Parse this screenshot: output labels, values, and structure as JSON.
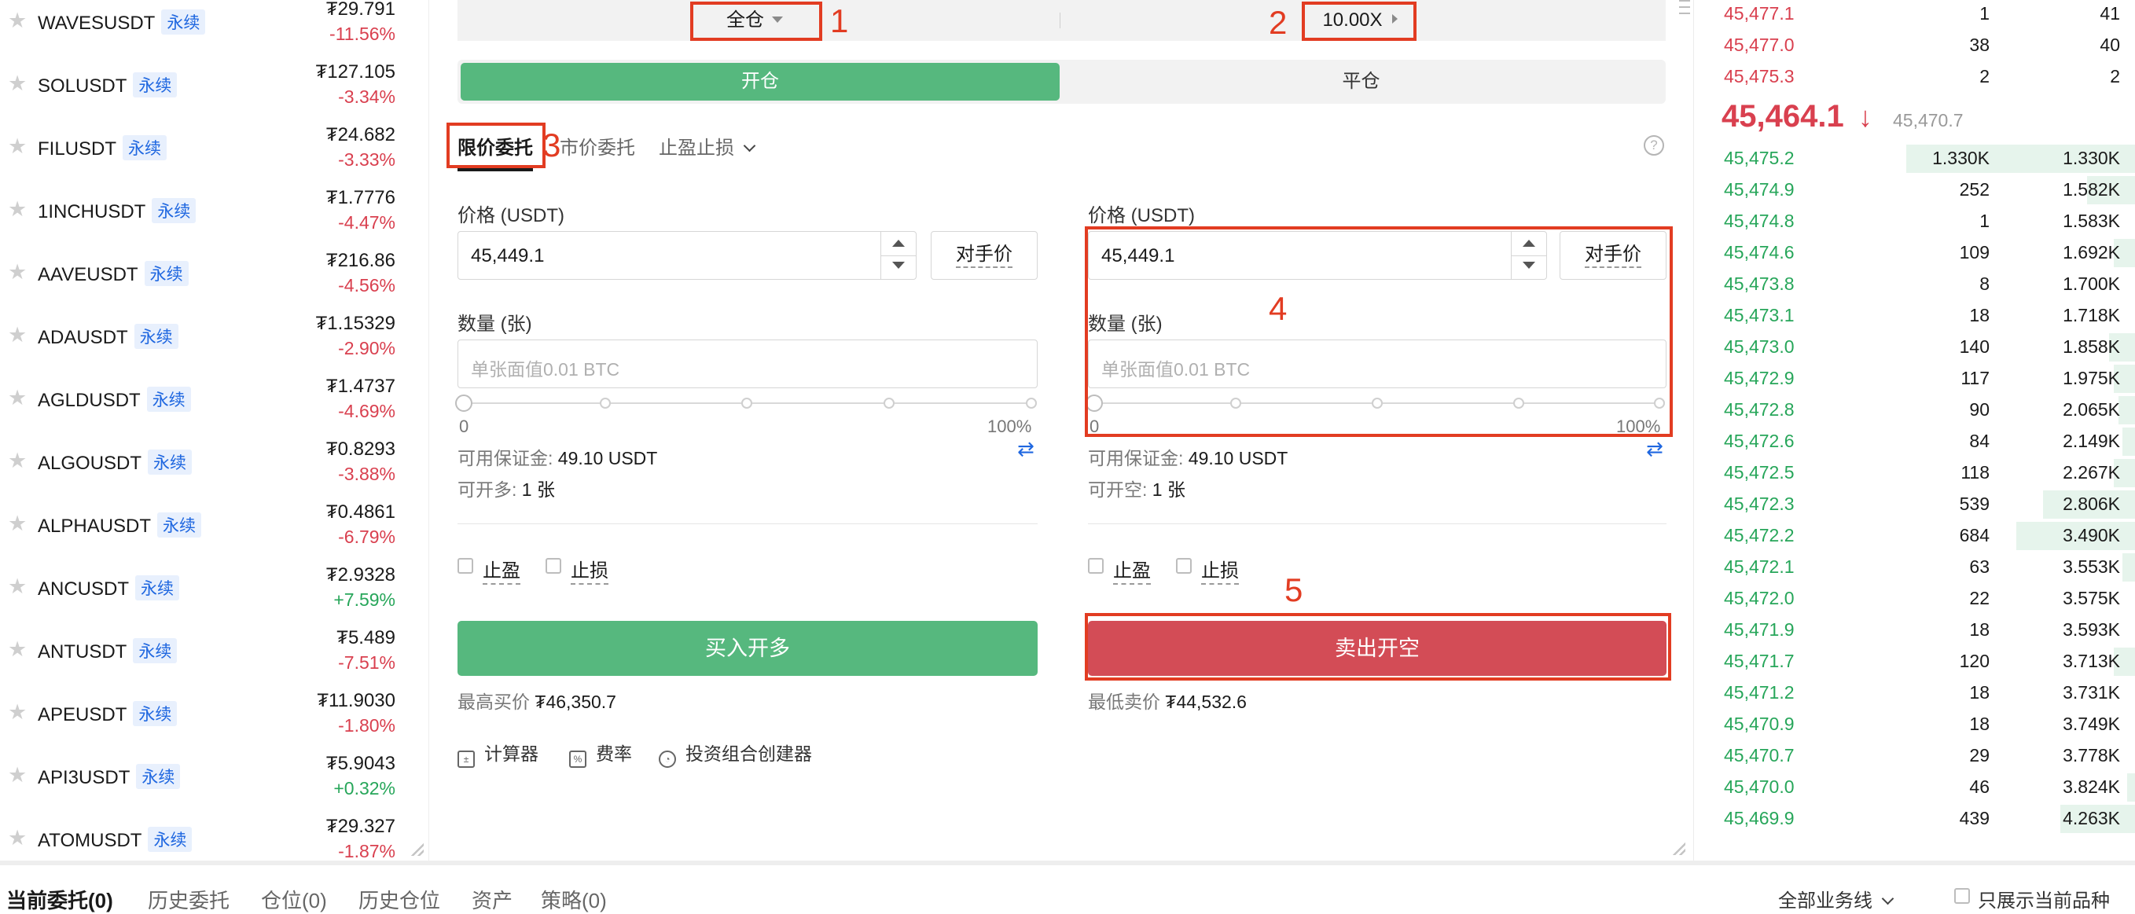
{
  "symbols": [
    {
      "name": "WAVESUSDT",
      "badge": "永续",
      "price": "₮29.791",
      "change": "-11.56%",
      "dir": "neg"
    },
    {
      "name": "SOLUSDT",
      "badge": "永续",
      "price": "₮127.105",
      "change": "-3.34%",
      "dir": "neg"
    },
    {
      "name": "FILUSDT",
      "badge": "永续",
      "price": "₮24.682",
      "change": "-3.33%",
      "dir": "neg"
    },
    {
      "name": "1INCHUSDT",
      "badge": "永续",
      "price": "₮1.7776",
      "change": "-4.47%",
      "dir": "neg"
    },
    {
      "name": "AAVEUSDT",
      "badge": "永续",
      "price": "₮216.86",
      "change": "-4.56%",
      "dir": "neg"
    },
    {
      "name": "ADAUSDT",
      "badge": "永续",
      "price": "₮1.15329",
      "change": "-2.90%",
      "dir": "neg"
    },
    {
      "name": "AGLDUSDT",
      "badge": "永续",
      "price": "₮1.4737",
      "change": "-4.69%",
      "dir": "neg"
    },
    {
      "name": "ALGOUSDT",
      "badge": "永续",
      "price": "₮0.8293",
      "change": "-3.88%",
      "dir": "neg"
    },
    {
      "name": "ALPHAUSDT",
      "badge": "永续",
      "price": "₮0.4861",
      "change": "-6.79%",
      "dir": "neg"
    },
    {
      "name": "ANCUSDT",
      "badge": "永续",
      "price": "₮2.9328",
      "change": "+7.59%",
      "dir": "pos"
    },
    {
      "name": "ANTUSDT",
      "badge": "永续",
      "price": "₮5.489",
      "change": "-7.51%",
      "dir": "neg"
    },
    {
      "name": "APEUSDT",
      "badge": "永续",
      "price": "₮11.9030",
      "change": "-1.80%",
      "dir": "neg"
    },
    {
      "name": "API3USDT",
      "badge": "永续",
      "price": "₮5.9043",
      "change": "+0.32%",
      "dir": "pos"
    },
    {
      "name": "ATOMUSDT",
      "badge": "永续",
      "price": "₮29.327",
      "change": "-1.87%",
      "dir": "neg"
    }
  ],
  "trade": {
    "margin_mode": "全仓",
    "leverage": "10.00X",
    "open_tab": "开仓",
    "close_tab": "平仓",
    "order_tabs": [
      "限价委托",
      "市价委托",
      "止盈止损"
    ],
    "price_label": "价格 (USDT)",
    "qty_label": "数量 (张)",
    "counter_price": "对手价",
    "buy": {
      "price_value": "45,449.1",
      "qty_placeholder": "单张面值0.01 BTC",
      "slider_min": "0",
      "slider_max": "100%",
      "margin_label": "可用保证金:",
      "margin_value": "49.10 USDT",
      "can_open_label": "可开多:",
      "can_open_value": "1 张",
      "tp_label": "止盈",
      "sl_label": "止损",
      "button": "买入开多",
      "limit_label": "最高买价",
      "limit_value": "₮46,350.7"
    },
    "sell": {
      "price_value": "45,449.1",
      "qty_placeholder": "单张面值0.01 BTC",
      "slider_min": "0",
      "slider_max": "100%",
      "margin_label": "可用保证金:",
      "margin_value": "49.10 USDT",
      "can_open_label": "可开空:",
      "can_open_value": "1 张",
      "tp_label": "止盈",
      "sl_label": "止损",
      "button": "卖出开空",
      "limit_label": "最低卖价",
      "limit_value": "₮44,532.6"
    },
    "tools": [
      "计算器",
      "费率",
      "投资组合创建器"
    ],
    "annotations": [
      "1",
      "2",
      "3",
      "4",
      "5"
    ]
  },
  "orderbook": {
    "asks": [
      {
        "price": "45,477.1",
        "qty": "1",
        "total": "41"
      },
      {
        "price": "45,477.0",
        "qty": "38",
        "total": "40"
      },
      {
        "price": "45,475.3",
        "qty": "2",
        "total": "2"
      }
    ],
    "last_price": "45,464.1",
    "last_arrow": "↓",
    "mark_price": "45,470.7",
    "bids": [
      {
        "price": "45,475.2",
        "qty": "1.330K",
        "total": "1.330K",
        "depth": 0.52
      },
      {
        "price": "45,474.9",
        "qty": "252",
        "total": "1.582K",
        "depth": 0.11
      },
      {
        "price": "45,474.8",
        "qty": "1",
        "total": "1.583K",
        "depth": 0.0
      },
      {
        "price": "45,474.6",
        "qty": "109",
        "total": "1.692K",
        "depth": 0.05
      },
      {
        "price": "45,473.8",
        "qty": "8",
        "total": "1.700K",
        "depth": 0.0
      },
      {
        "price": "45,473.1",
        "qty": "18",
        "total": "1.718K",
        "depth": 0.0
      },
      {
        "price": "45,473.0",
        "qty": "140",
        "total": "1.858K",
        "depth": 0.06
      },
      {
        "price": "45,472.9",
        "qty": "117",
        "total": "1.975K",
        "depth": 0.05
      },
      {
        "price": "45,472.8",
        "qty": "90",
        "total": "2.065K",
        "depth": 0.04
      },
      {
        "price": "45,472.6",
        "qty": "84",
        "total": "2.149K",
        "depth": 0.03
      },
      {
        "price": "45,472.5",
        "qty": "118",
        "total": "2.267K",
        "depth": 0.05
      },
      {
        "price": "45,472.3",
        "qty": "539",
        "total": "2.806K",
        "depth": 0.21
      },
      {
        "price": "45,472.2",
        "qty": "684",
        "total": "3.490K",
        "depth": 0.27
      },
      {
        "price": "45,472.1",
        "qty": "63",
        "total": "3.553K",
        "depth": 0.03
      },
      {
        "price": "45,472.0",
        "qty": "22",
        "total": "3.575K",
        "depth": 0.0
      },
      {
        "price": "45,471.9",
        "qty": "18",
        "total": "3.593K",
        "depth": 0.0
      },
      {
        "price": "45,471.7",
        "qty": "120",
        "total": "3.713K",
        "depth": 0.05
      },
      {
        "price": "45,471.2",
        "qty": "18",
        "total": "3.731K",
        "depth": 0.0
      },
      {
        "price": "45,470.9",
        "qty": "18",
        "total": "3.749K",
        "depth": 0.0
      },
      {
        "price": "45,470.7",
        "qty": "29",
        "total": "3.778K",
        "depth": 0.0
      },
      {
        "price": "45,470.0",
        "qty": "46",
        "total": "3.824K",
        "depth": 0.02
      },
      {
        "price": "45,469.9",
        "qty": "439",
        "total": "4.263K",
        "depth": 0.17
      }
    ]
  },
  "bottom": {
    "tabs": [
      "当前委托(0)",
      "历史委托",
      "仓位(0)",
      "历史仓位",
      "资产",
      "策略(0)"
    ],
    "scope": "全部业务线",
    "only_current": "只展示当前品种"
  },
  "colors": {
    "buy": "#56b87e",
    "sell": "#d34c56",
    "annotation": "#e23c22",
    "link": "#1f67e0"
  }
}
